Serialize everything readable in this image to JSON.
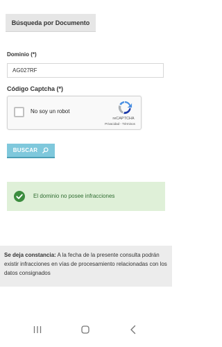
{
  "tab": {
    "label": "Búsqueda por Documento"
  },
  "form": {
    "dominio_label": "Dominio (*)",
    "dominio_value": "AG027RF",
    "captcha_label": "Código Captcha (*)"
  },
  "captcha": {
    "checkbox_label": "No soy un robot",
    "brand": "reCAPTCHA",
    "privacy": "Privacidad",
    "separator": " - ",
    "terms": "Términos"
  },
  "search_button": {
    "label": "BUSCAR",
    "icon": "search-icon"
  },
  "result": {
    "message": "El dominio no posee infracciones",
    "icon": "check-circle-icon"
  },
  "notice": {
    "bold": "Se deja constancia:",
    "text": " A la fecha de la presente consulta podrán existir infracciones en vías de procesamiento relacionadas con los datos consignados"
  },
  "navbar": {
    "icons": [
      "recent-apps-icon",
      "home-icon",
      "back-icon"
    ]
  },
  "colors": {
    "button": "#7fc8dc",
    "alert_bg": "#dff0d8",
    "alert_text": "#2f6c31",
    "check": "#3c8d3f",
    "notice_bg": "#ececec"
  }
}
